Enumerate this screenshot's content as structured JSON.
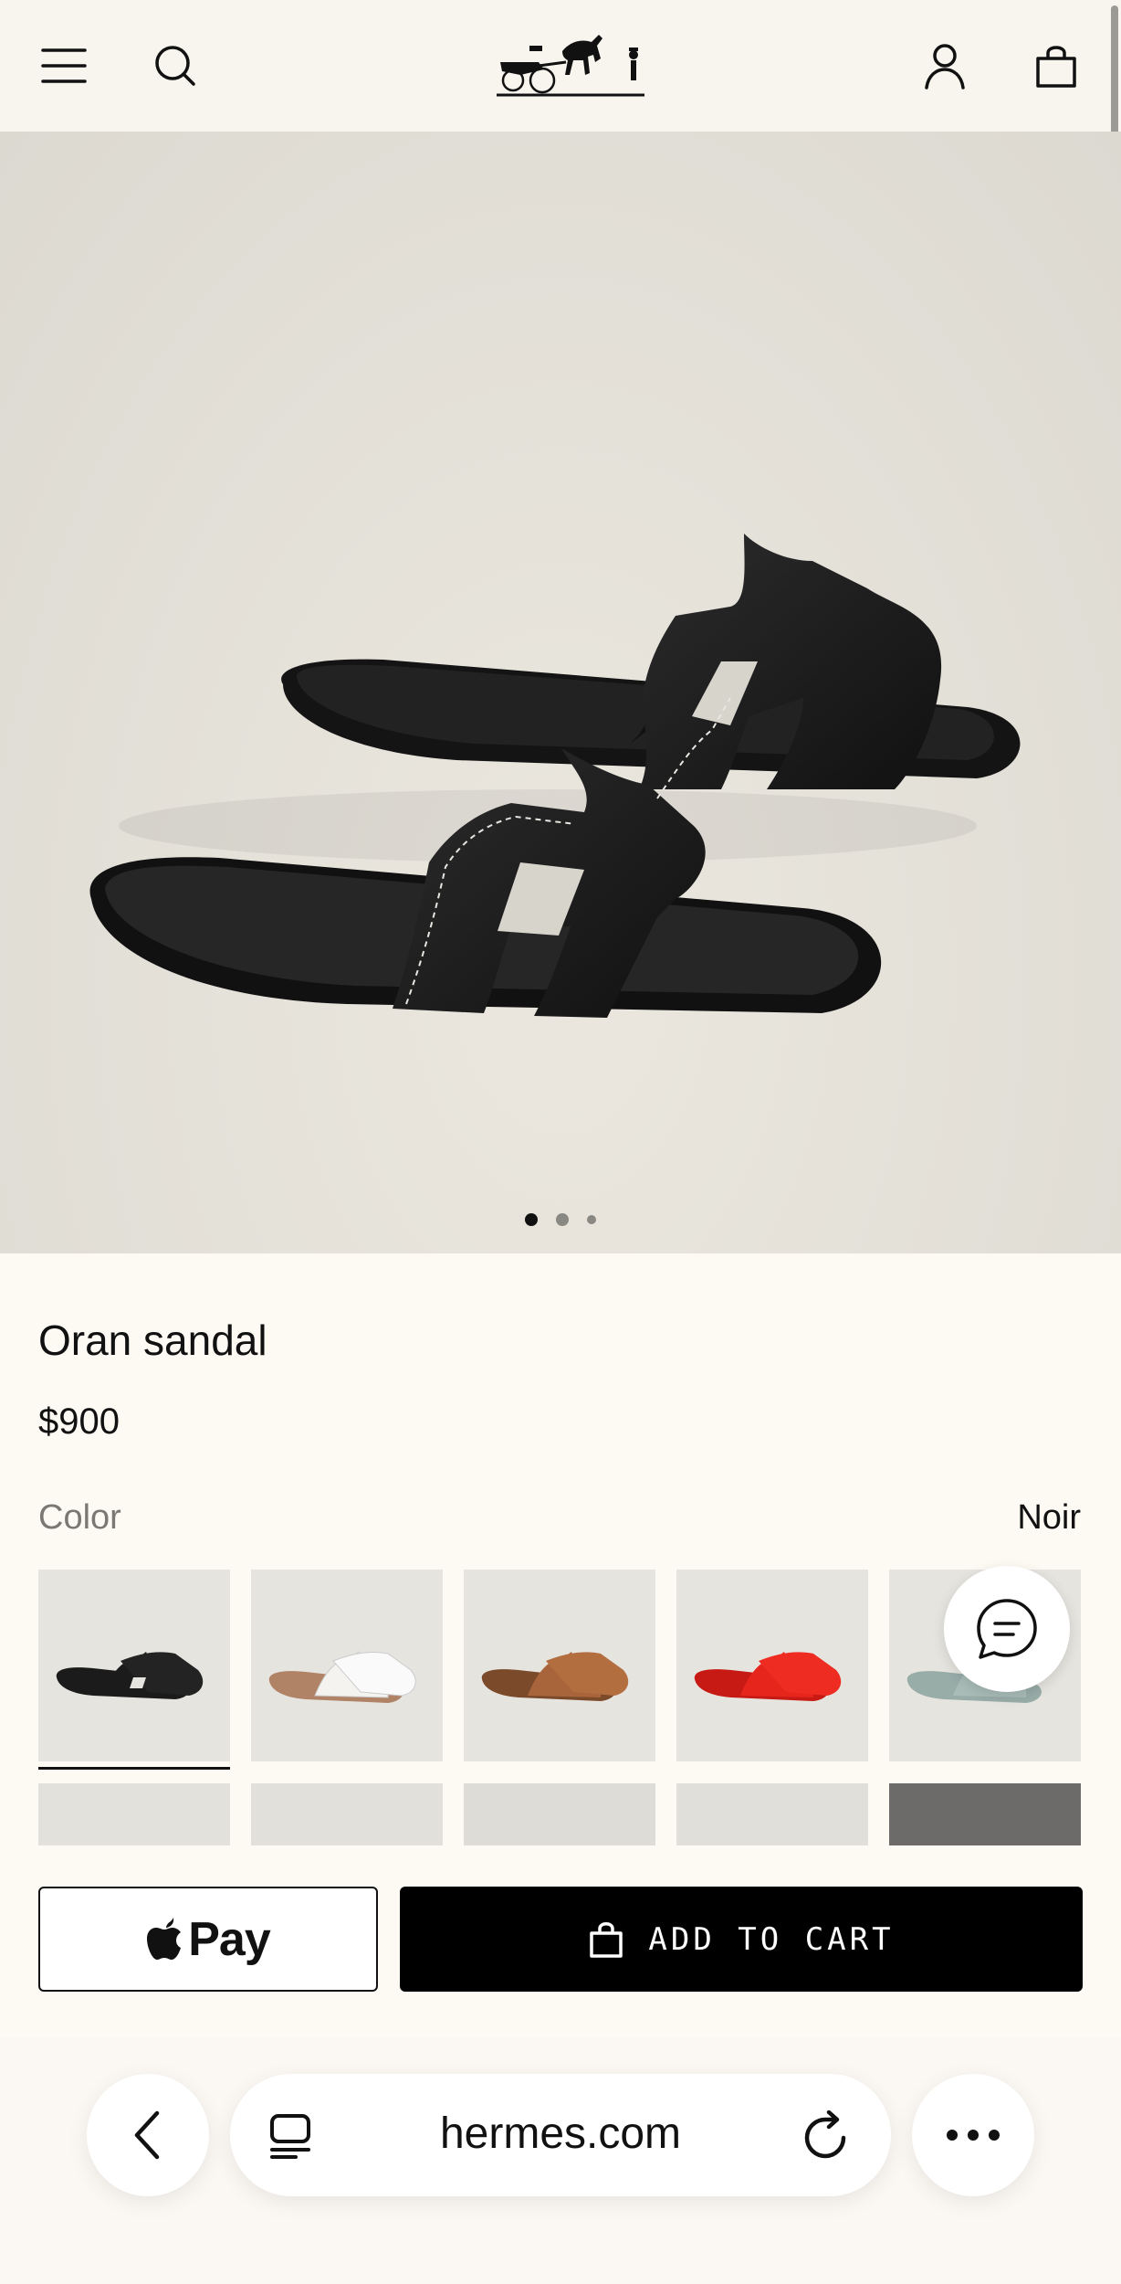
{
  "header": {
    "menu_icon": "menu-icon",
    "search_icon": "search-icon",
    "logo": "hermes-carriage-logo",
    "account_icon": "account-icon",
    "bag_icon": "shopping-bag-icon"
  },
  "gallery": {
    "image": "black-oran-sandals-image",
    "dots_total": 3,
    "active_dot": 1
  },
  "product": {
    "title": "Oran sandal",
    "price": "$900",
    "color_label": "Color",
    "color_value": "Noir"
  },
  "swatches": [
    {
      "name": "Noir",
      "color": "#1b1b1b",
      "selected": true
    },
    {
      "name": "White",
      "color": "#f2f1ee",
      "selected": false
    },
    {
      "name": "Gold",
      "color": "#a8643a",
      "selected": false
    },
    {
      "name": "Red",
      "color": "#e6251d",
      "selected": false
    },
    {
      "name": "Blue",
      "color": "#a9bcb8",
      "selected": false
    }
  ],
  "actions": {
    "apple_pay_label": "Pay",
    "add_to_cart_label": "ADD TO CART"
  },
  "browser": {
    "url": "hermes.com",
    "back_icon": "back-chevron-icon",
    "tabs_icon": "tabs-icon",
    "reload_icon": "reload-icon",
    "more_icon": "more-icon"
  },
  "colors": {
    "background": "#fdf9f3",
    "header_bg": "#f8f5ee",
    "accent": "#000000"
  }
}
